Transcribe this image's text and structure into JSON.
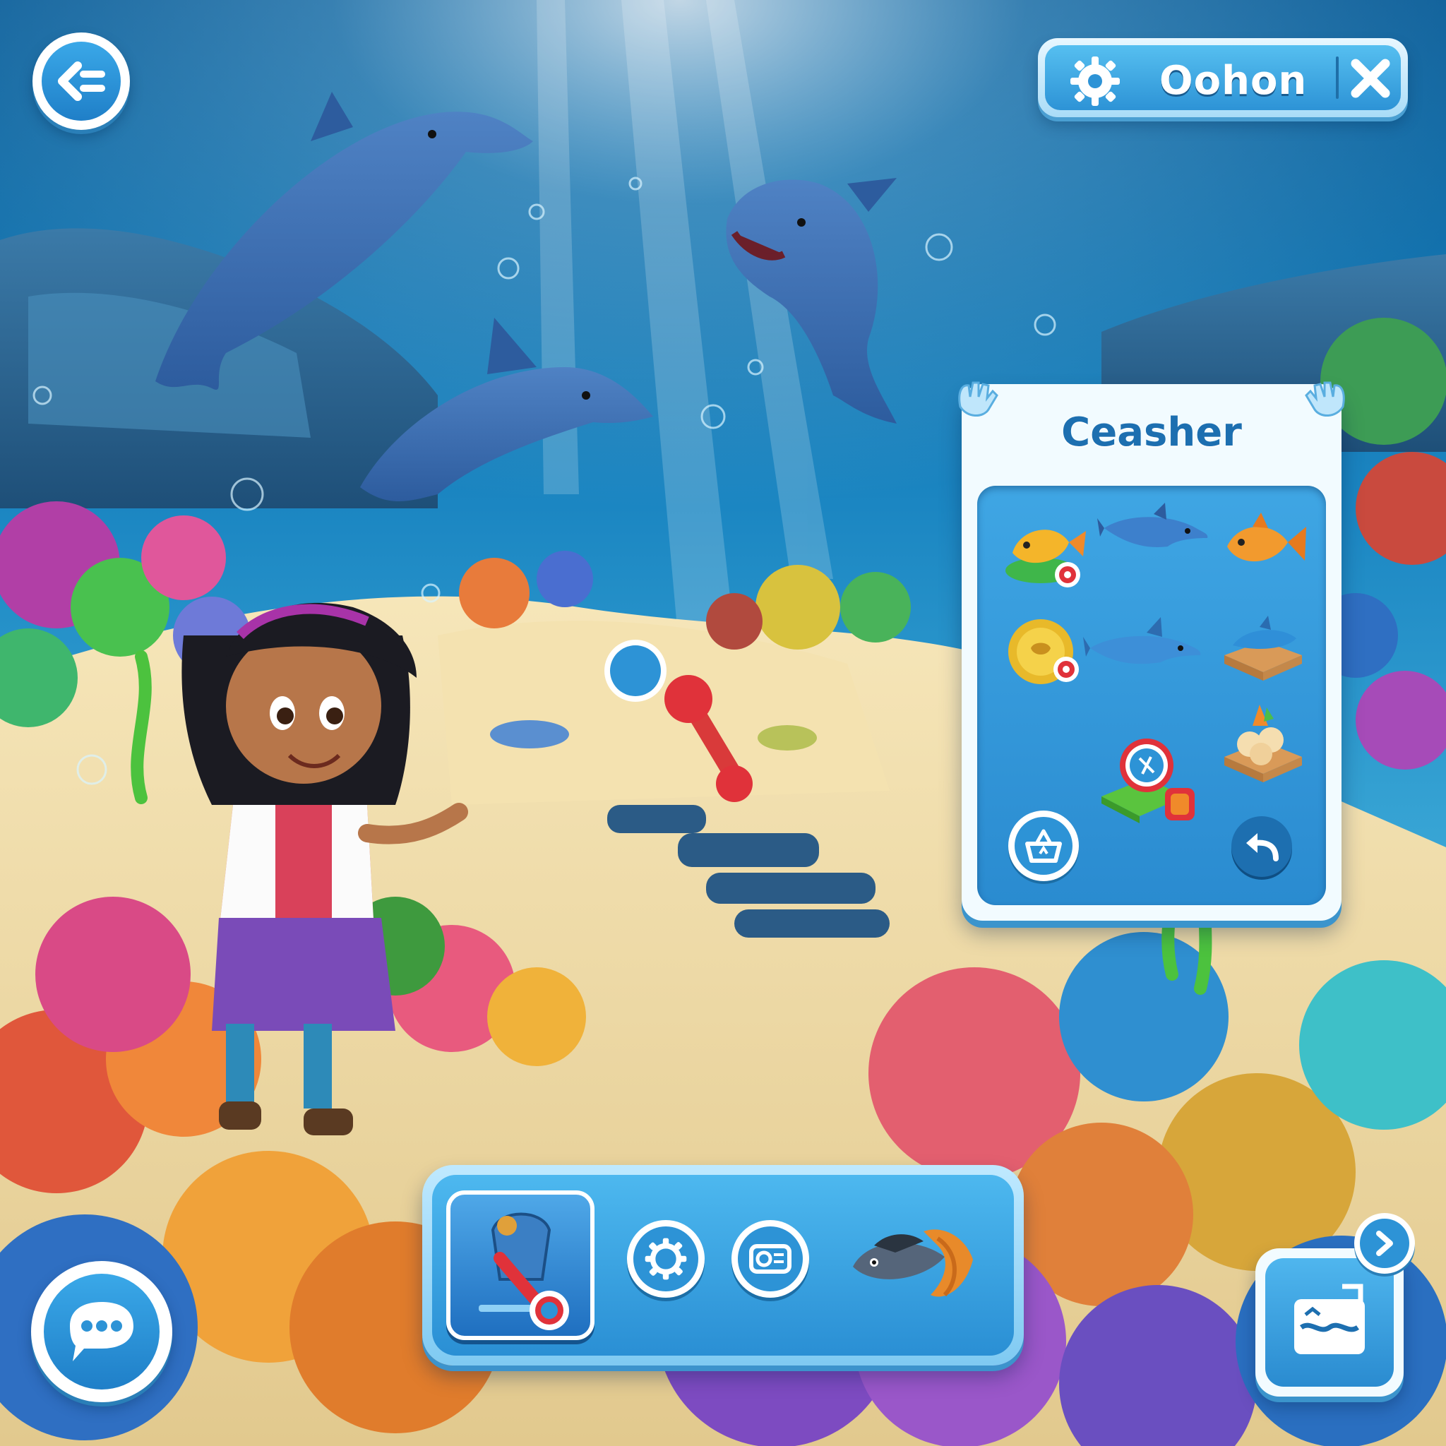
{
  "top_bar": {
    "title": "Oohon",
    "settings_icon": "gear-icon",
    "close_icon": "close-icon"
  },
  "back_button": {
    "icon": "back-arrow-icon"
  },
  "collection_panel": {
    "title": "Ceasher",
    "items": [
      {
        "icon": "yellow-fish-icon",
        "has_target_badge": true
      },
      {
        "icon": "dolphin-icon",
        "has_target_badge": false
      },
      {
        "icon": "orange-fish-icon",
        "has_target_badge": false
      },
      {
        "icon": "gold-coin-icon",
        "has_target_badge": true
      },
      {
        "icon": "dolphin-icon",
        "has_target_badge": false
      },
      {
        "icon": "dolphin-statue-icon",
        "has_target_badge": false
      },
      {
        "icon": "map-badge-icon",
        "has_target_badge": false
      },
      {
        "icon": "food-crate-icon",
        "has_target_badge": false
      }
    ],
    "bottom_left_icon": "basket-icon",
    "bottom_right_icon": "undo-icon"
  },
  "hotbar": {
    "items": [
      {
        "icon": "diving-tool-icon",
        "selected": true
      },
      {
        "icon": "gear-icon",
        "selected": false
      },
      {
        "icon": "camera-card-icon",
        "selected": false
      },
      {
        "icon": "fish-icon",
        "selected": false
      }
    ]
  },
  "chat_button": {
    "icon": "chat-bubble-icon"
  },
  "map_button": {
    "icon": "sea-map-icon",
    "badge_icon": "chevron-right-icon"
  },
  "colors": {
    "water_top": "#0a5e9a",
    "water_mid": "#1e8fc8",
    "sand": "#f0dca8",
    "ui_blue": "#2d93d6",
    "ui_light": "#e9f7ff",
    "accent_red": "#e0323a"
  }
}
